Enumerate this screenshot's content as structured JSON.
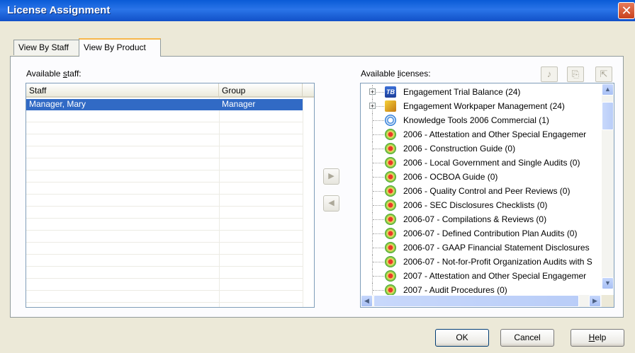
{
  "window": {
    "title": "License Assignment",
    "close_glyph": "✕"
  },
  "tabs": [
    {
      "label": "View By Staff",
      "active": false
    },
    {
      "label": "View By Product",
      "active": true
    }
  ],
  "staff_panel": {
    "label_prefix": "Available ",
    "label_accel": "s",
    "label_suffix": "taff:",
    "columns": [
      "Staff",
      "Group"
    ],
    "rows": [
      {
        "staff": "Manager, Mary",
        "group": "Manager",
        "selected": true
      }
    ]
  },
  "move_buttons": {
    "add_glyph": "▶",
    "remove_glyph": "◀"
  },
  "licenses_panel": {
    "label_prefix": "Available ",
    "label_accel": "l",
    "label_suffix": "icenses:",
    "toolbar_icons": [
      "assign-icon",
      "copy-icon",
      "remove-license-icon"
    ],
    "items": [
      {
        "label": "Engagement Trial Balance (24)",
        "icon": "trial-balance-icon",
        "expandable": true
      },
      {
        "label": "Engagement Workpaper Management (24)",
        "icon": "workpaper-icon",
        "expandable": true
      },
      {
        "label": "Knowledge Tools 2006 Commercial (1)",
        "icon": "knowledge-tools-icon",
        "expandable": false
      },
      {
        "label": "2006 - Attestation and Other Special Engagemer",
        "icon": "product-icon",
        "expandable": false
      },
      {
        "label": "2006 - Construction Guide (0)",
        "icon": "product-icon",
        "expandable": false
      },
      {
        "label": "2006 - Local Government and Single Audits (0)",
        "icon": "product-icon",
        "expandable": false
      },
      {
        "label": "2006 - OCBOA Guide (0)",
        "icon": "product-icon",
        "expandable": false
      },
      {
        "label": "2006 - Quality Control and Peer Reviews (0)",
        "icon": "product-icon",
        "expandable": false
      },
      {
        "label": "2006 - SEC Disclosures Checklists (0)",
        "icon": "product-icon",
        "expandable": false
      },
      {
        "label": "2006-07 - Compilations & Reviews (0)",
        "icon": "product-icon",
        "expandable": false
      },
      {
        "label": "2006-07 - Defined Contribution Plan Audits (0)",
        "icon": "product-icon",
        "expandable": false
      },
      {
        "label": "2006-07 - GAAP Financial Statement Disclosures",
        "icon": "product-icon",
        "expandable": false
      },
      {
        "label": "2006-07 - Not-for-Profit Organization Audits with S",
        "icon": "product-icon",
        "expandable": false
      },
      {
        "label": "2007 - Attestation and Other Special Engagemer",
        "icon": "product-icon",
        "expandable": false
      },
      {
        "label": "2007 - Audit Procedures (0)",
        "icon": "product-icon",
        "expandable": false
      }
    ]
  },
  "buttons": {
    "ok": "OK",
    "cancel": "Cancel",
    "help_accel": "H",
    "help_rest": "elp"
  }
}
